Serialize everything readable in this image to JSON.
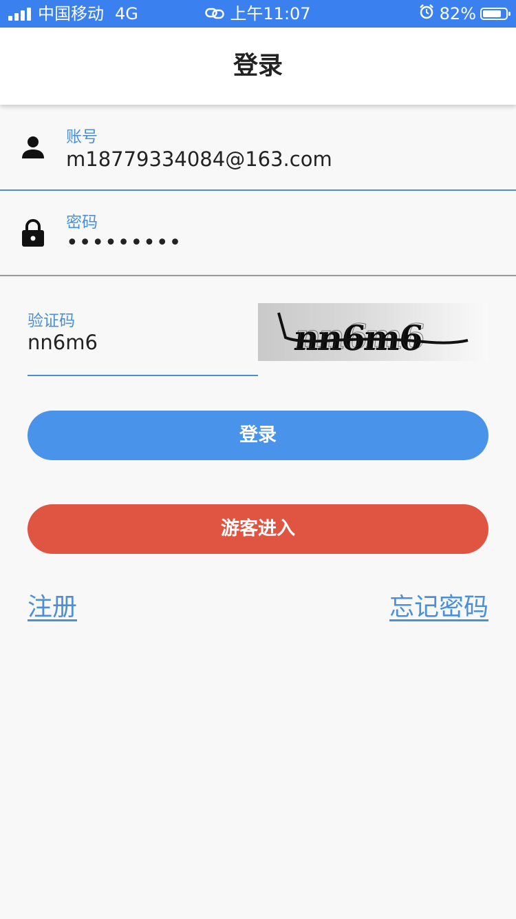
{
  "status_bar": {
    "carrier": "中国移动",
    "network": "4G",
    "time": "上午11:07",
    "battery": "82%",
    "battery_level": 0.82,
    "icons": [
      "signal-icon",
      "link-icon",
      "alarm-icon",
      "battery-icon"
    ]
  },
  "navbar": {
    "title": "登录"
  },
  "form": {
    "account": {
      "label": "账号",
      "value": "m18779334084@163.com",
      "icon": "person-icon"
    },
    "password": {
      "label": "密码",
      "value": "•••••••••",
      "icon": "lock-icon"
    },
    "captcha": {
      "label": "验证码",
      "value": "nn6m6",
      "image_text": "nn6m6"
    }
  },
  "buttons": {
    "login": "登录",
    "guest": "游客进入"
  },
  "links": {
    "register": "注册",
    "forgot_password": "忘记密码"
  },
  "colors": {
    "status_bar": "#3a80ee",
    "accent": "#4a90d9",
    "login_button": "#4a93ea",
    "guest_button": "#e05442",
    "background": "#f8f8f8"
  }
}
